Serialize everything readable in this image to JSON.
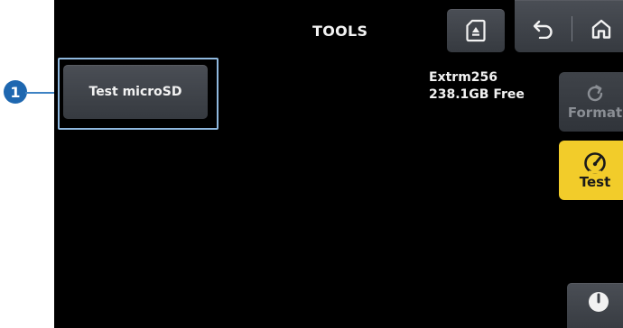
{
  "callout": {
    "number": "1"
  },
  "header": {
    "title": "TOOLS",
    "icons": {
      "sd_card": "sd-card-icon",
      "back": "back-arrow-icon",
      "home": "home-icon"
    }
  },
  "main": {
    "test_microsd_label": "Test microSD"
  },
  "storage": {
    "name": "Extrm256",
    "free": "238.1GB Free"
  },
  "side_buttons": {
    "format_label": "Format",
    "format_icon": "refresh-icon",
    "test_label": "Test",
    "test_icon": "speedometer-icon",
    "power_icon": "power-icon"
  },
  "colors": {
    "background": "#000000",
    "button": "#3f4349",
    "accent_yellow": "#f2cc2a",
    "callout_blue": "#1e67b0",
    "highlight_border": "#8fb8de"
  }
}
